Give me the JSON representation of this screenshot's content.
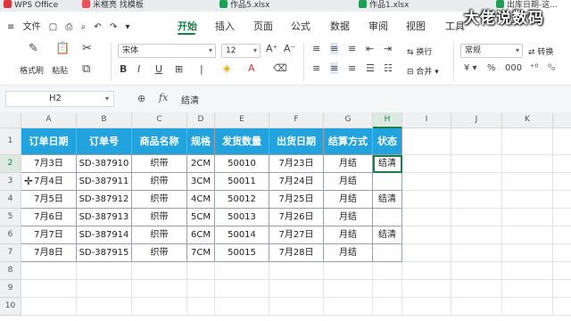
{
  "tabs": [
    {
      "label": "WPS Office",
      "icon": "wps-logo-icon",
      "color": "#d9363e"
    },
    {
      "label": "米框亮 找模板",
      "icon": "docer-icon",
      "color": "#e8505b"
    },
    {
      "label": "作品5.xlsx",
      "icon": "sheet-icon",
      "color": "#1f9d55"
    },
    {
      "label": "作品1.xlsx",
      "icon": "sheet-icon",
      "color": "#1f9d55"
    },
    {
      "label": "出库日期-这...",
      "icon": "sheet-icon",
      "color": "#1f9d55"
    }
  ],
  "menu": {
    "file": "文件",
    "items": [
      "开始",
      "插入",
      "页面",
      "公式",
      "数据",
      "审阅",
      "视图",
      "工具"
    ],
    "active": "开始"
  },
  "ribbon": {
    "format_painter": "格式刷",
    "paste": "粘贴",
    "font_name": "宋体",
    "font_size": "12",
    "wrap": "换行",
    "merge": "合并",
    "number_format": "常规",
    "convert": "转换"
  },
  "formula_bar": {
    "cell_ref": "H2",
    "zoom_icon": "zoom-icon",
    "fx": "fx",
    "value": "结清"
  },
  "columns": [
    "A",
    "B",
    "C",
    "D",
    "E",
    "F",
    "G",
    "H",
    "I",
    "J",
    "K",
    "L"
  ],
  "rows": [
    "1",
    "2",
    "3",
    "4",
    "5",
    "6",
    "7",
    "8",
    "9",
    "10"
  ],
  "table": {
    "headers": [
      "订单日期",
      "订单号",
      "商品名称",
      "规格",
      "发货数量",
      "出货日期",
      "结算方式",
      "状态"
    ],
    "rows": [
      [
        "7月3日",
        "SD-387910",
        "织带",
        "2CM",
        "50010",
        "7月23日",
        "月结",
        "结清"
      ],
      [
        "7月4日",
        "SD-387911",
        "织带",
        "3CM",
        "50011",
        "7月24日",
        "月结",
        ""
      ],
      [
        "7月5日",
        "SD-387912",
        "织带",
        "4CM",
        "50012",
        "7月25日",
        "月结",
        "结清"
      ],
      [
        "7月6日",
        "SD-387913",
        "织带",
        "5CM",
        "50013",
        "7月26日",
        "月结",
        ""
      ],
      [
        "7月7日",
        "SD-387914",
        "织带",
        "6CM",
        "50014",
        "7月27日",
        "月结",
        "结清"
      ],
      [
        "7月8日",
        "SD-387915",
        "织带",
        "7CM",
        "50015",
        "7月28日",
        "月结",
        ""
      ]
    ]
  },
  "selected_cell": "H2",
  "watermark": "大佬说数码",
  "colors": {
    "accent": "#1a7f4b",
    "header_fill": "#23a3de"
  }
}
